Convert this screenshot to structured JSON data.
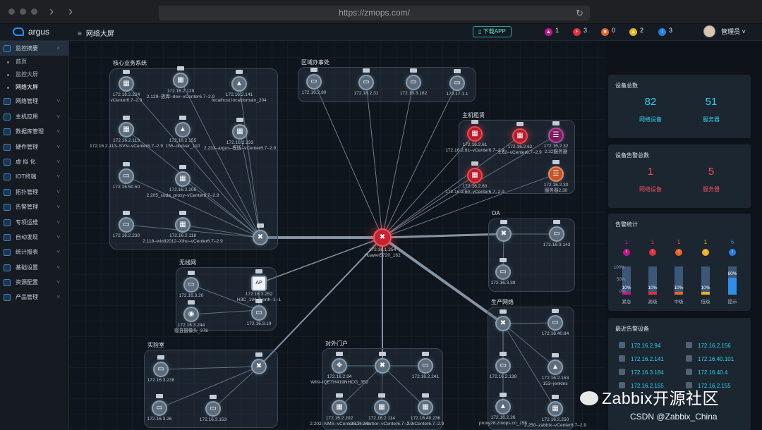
{
  "browser": {
    "url": "https://zmops.com/"
  },
  "header": {
    "app_name": "argus",
    "page_title": "网络大屏",
    "download_label": "下载APP",
    "alerts": [
      {
        "icon": "fire-icon",
        "count": "1",
        "color": "#c2178d"
      },
      {
        "icon": "bolt-icon",
        "count": "3",
        "color": "#e0303c"
      },
      {
        "icon": "alarm-icon",
        "count": "0",
        "color": "#e8632b"
      },
      {
        "icon": "warning-icon",
        "count": "2",
        "color": "#e8b21f"
      },
      {
        "icon": "info-icon",
        "count": "3",
        "color": "#2b7de0"
      }
    ],
    "user": "管理员"
  },
  "sidebar": {
    "items": [
      {
        "label": "监控摘要",
        "active": true,
        "subs": [
          "首页",
          "监控大屏",
          "网络大屏"
        ]
      },
      {
        "label": "网络管理"
      },
      {
        "label": "主机应用"
      },
      {
        "label": "数据库管理"
      },
      {
        "label": "硬件管理"
      },
      {
        "label": "虚 拟 化"
      },
      {
        "label": "IOT终端"
      },
      {
        "label": "拓扑管理"
      },
      {
        "label": "告警管理"
      },
      {
        "label": "专项运维"
      },
      {
        "label": "自动发现"
      },
      {
        "label": "统计报表"
      },
      {
        "label": "基础设置"
      },
      {
        "label": "资源配置"
      },
      {
        "label": "产品管理"
      }
    ]
  },
  "topology": {
    "groups": {
      "core": "核心业务系统",
      "branch": "区域办事处",
      "host": "主机租赁",
      "oa": "OA",
      "wireless": "无线网",
      "lab": "实验室",
      "portal": "对外门户",
      "prod": "生产网络"
    },
    "center": {
      "label1": "172.16.1.254",
      "label2": "Huawei5720_162"
    },
    "nodes": {
      "c1": "172.16.2.224\nvCenter6.7–2.9",
      "c2": "172.16.2.129\n2.129–族库–dev–vCenter6.7–2.9",
      "c3": "172.16.2.141\nlocalhost.localdomain_204",
      "c4": "172.16.2.113\n172.16.2.113–SVN–vCenter6.7–2.9",
      "c5": "172.16.2.155\n155–docker_110",
      "c6": "172.16.2.233\n2.233–argus–模版–vCenter6.7–2.9",
      "c7": "172.16.50.50",
      "c8": "172.16.2.205\n2.205_suda_proxy–vCenter6.7–2.9",
      "c9": "172.16.2.230",
      "c10": "172.16.2.118\n2.118–win82012–Xihu–vCenter6.7–2.9",
      "b1": "172.16.2.80",
      "b2": "172.16.2.31",
      "b3": "172.16.3.162",
      "b4": "172.17.1.1",
      "h1": "172.16.2.61\n172.16.2.61–vCenter6.7–2.9",
      "h2": "172.16.2.62\n2.62–vCenter6.7–2.9",
      "h3": "172.16.2.32\n2.32服务器",
      "h4": "172.16.2.60\n172.16.2.60–vCenter6.7–2.9",
      "h5": "172.16.2.30\n服务器2.30",
      "o1": "",
      "o2": "172.16.3.143",
      "o3": "172.16.3.39",
      "w1": "172.16.3.20",
      "w2": "172.16.3.252\nH3C_194–North–1–1",
      "w3": "172.16.3.244\n临县摄像头_378",
      "w4": "172.16.3.19",
      "l1": "172.16.3.238",
      "l2": "172.16.3.26",
      "l3": "172.16.3.153",
      "p1": "172.16.2.94\nWIN–IQETH419NHCG_352",
      "p2": "172.16.2.241",
      "p3": "172.16.2.202\n2.202–NMS–vCenter6.7–2.9",
      "p4": "172.16.2.114\n2.114–Harbor–vCenter6.7–2.9",
      "p5": "172.16.40.236\n2–vCenter6.7–2.9",
      "s1": "172.16.40.84",
      "s2": "172.16.2.138",
      "s3": "172.16.2.153\n153–jenkins",
      "s4": "172.16.2.26\nproxy28.zmops.cn_155",
      "s5": "172.16.2.250\n2.250–zabbix–vCenter6.7–2.9"
    }
  },
  "summary": {
    "title": "设备总数",
    "network_count": "82",
    "network_label": "网络设备",
    "server_count": "51",
    "server_label": "服务器"
  },
  "alarm_summary": {
    "title": "设备告警总数",
    "network_count": "1",
    "network_label": "网络设备",
    "server_count": "5",
    "server_label": "服务器"
  },
  "alarm_stats": {
    "title": "告警统计",
    "y_ticks": [
      "100%",
      "50%",
      "0%"
    ],
    "chart_data": {
      "type": "bar",
      "categories": [
        "紧急",
        "高级",
        "中级",
        "低级",
        "提示"
      ],
      "values": [
        10,
        10,
        10,
        10,
        60
      ],
      "counts": [
        "1",
        "1",
        "1",
        "1",
        "6"
      ],
      "colors": [
        "#c2178d",
        "#e0303c",
        "#e8632b",
        "#e8b21f",
        "#2b7de0"
      ],
      "ylim": [
        0,
        100
      ]
    }
  },
  "recent": {
    "title": "最近告警设备",
    "items": [
      "172.16.2.94",
      "172.16.2.156",
      "172.16.2.141",
      "172.16.40.101",
      "172.16.3.184",
      "172.16.40.4",
      "172.16.2.155",
      "172.16.2.155"
    ]
  },
  "watermark": {
    "text": "Zabbix开源社区",
    "credit": "CSDN @Zabbix_China"
  }
}
